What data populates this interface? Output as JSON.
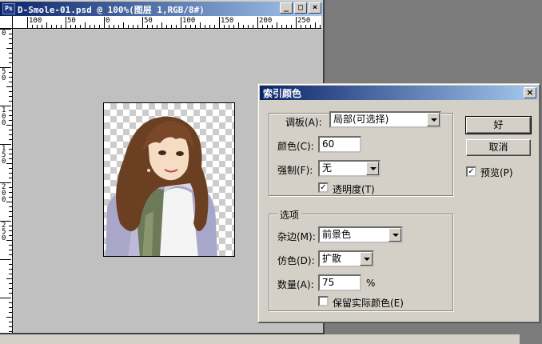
{
  "document": {
    "title": "D-Smole-01.psd @ 100%(图层 1,RGB/8#)",
    "icon": "ps-icon",
    "minimize": "_",
    "maximize": "□",
    "close": "×",
    "ruler_h": [
      "100",
      "50",
      "0",
      "50",
      "100",
      "150",
      "200",
      "250"
    ],
    "ruler_v": [
      "0",
      "50",
      "100",
      "150",
      "200",
      "250"
    ]
  },
  "dialog": {
    "title": "索引颜色",
    "close": "×",
    "palette_group": {
      "palette_label": "调板(A):",
      "palette_value": "局部(可选择)",
      "colors_label": "颜色(C):",
      "colors_value": "60",
      "forced_label": "强制(F):",
      "forced_value": "无",
      "transparency_label": "透明度(T)",
      "transparency_checked": true
    },
    "options_group": {
      "title": "选项",
      "matte_label": "杂边(M):",
      "matte_value": "前景色",
      "dither_label": "仿色(D):",
      "dither_value": "扩散",
      "amount_label": "数量(A):",
      "amount_value": "75",
      "amount_unit": "%",
      "preserve_label": "保留实际颜色(E)",
      "preserve_checked": false
    },
    "buttons": {
      "ok": "好",
      "cancel": "取消",
      "preview_label": "预览(P)",
      "preview_checked": true
    }
  }
}
